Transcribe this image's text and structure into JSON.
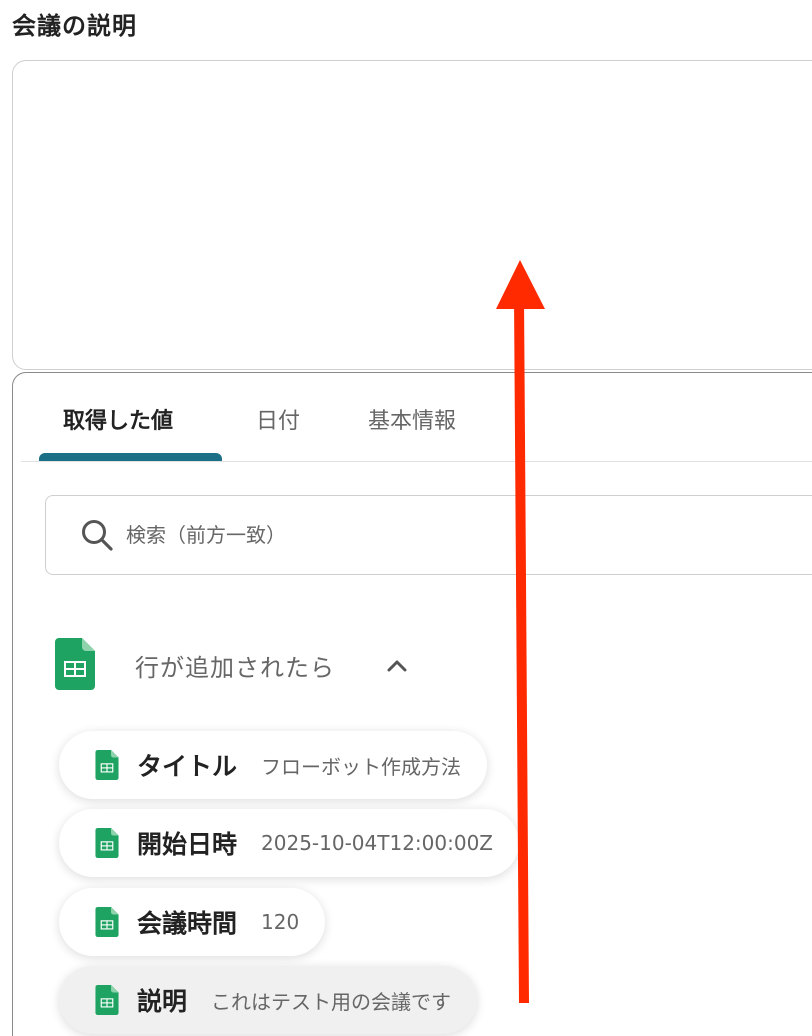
{
  "field": {
    "label": "会議の説明",
    "value": ""
  },
  "popup": {
    "tabs": [
      {
        "label": "取得した値",
        "active": true
      },
      {
        "label": "日付",
        "active": false
      },
      {
        "label": "基本情報",
        "active": false
      }
    ],
    "search": {
      "placeholder": "検索（前方一致）",
      "icon": "search-icon"
    },
    "section": {
      "title": "行が追加されたら",
      "icon": "google-sheets-icon",
      "toggle_icon": "chevron-up-icon"
    },
    "items": [
      {
        "name": "タイトル",
        "value": "フローボット作成方法"
      },
      {
        "name": "開始日時",
        "value": "2025-10-04T12:00:00Z"
      },
      {
        "name": "会議時間",
        "value": "120"
      },
      {
        "name": "説明",
        "value": "これはテスト用の会議です"
      }
    ]
  },
  "colors": {
    "tab_accent": "#1b6f86",
    "sheets_green": "#1ea362",
    "annotation_arrow": "#ff2a00"
  }
}
